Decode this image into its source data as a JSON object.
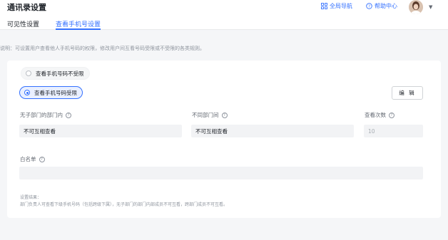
{
  "header": {
    "title": "通讯录设置",
    "tabs": [
      {
        "label": "可见性设置",
        "active": false
      },
      {
        "label": "查看手机号设置",
        "active": true
      }
    ],
    "global_nav_label": "全局导航",
    "help_center_label": "帮助中心"
  },
  "description": "说明：可设置用户查看他人手机号码的权限，修改用户间互看号码受限或不受限的各类规则。",
  "options": {
    "unrestricted_label": "查看手机号码不受限",
    "restricted_label": "查看手机号码受限",
    "selected": "restricted"
  },
  "edit_button_label": "编 辑",
  "fields": {
    "no_dept_label": "无子部门的部门内",
    "no_dept_value": "不可互相查看",
    "diff_dept_label": "不同部门间",
    "diff_dept_value": "不可互相查看",
    "view_count_label": "查看次数",
    "view_count_value": "10",
    "whitelist_label": "白名单",
    "whitelist_value": ""
  },
  "result": {
    "title": "设置结果：",
    "text": "部门负责人可查看下级手机号码（包括跨级下属），无子部门的部门内部成员不可互看，跨部门成员不可互看。"
  },
  "colors": {
    "accent": "#3370ff",
    "background": "#f5f6f8"
  }
}
